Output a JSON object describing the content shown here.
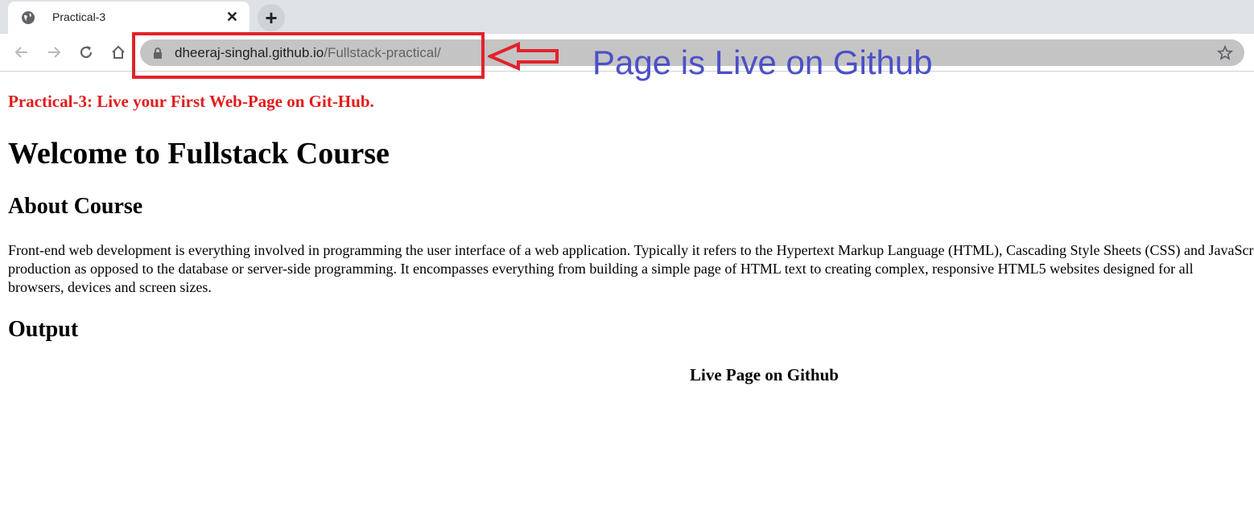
{
  "browser": {
    "tab": {
      "title": "Practical-3",
      "favicon": "globe-icon",
      "close_icon": "close-icon"
    },
    "new_tab_icon": "plus-icon",
    "toolbar": {
      "back_icon": "back-arrow-icon",
      "forward_icon": "forward-arrow-icon",
      "reload_icon": "reload-icon",
      "home_icon": "home-icon",
      "lock_icon": "lock-icon",
      "bookmark_icon": "star-icon",
      "url_host": "dheeraj-singhal.github.io",
      "url_path": "/Fullstack-practical/"
    }
  },
  "annotation": {
    "text": "Page is Live on Github",
    "box_color": "#e2232a",
    "text_color": "#4b50c8"
  },
  "page": {
    "practical_title": "Practical-3: Live your First Web-Page on Git-Hub.",
    "heading": "Welcome to Fullstack Course",
    "about_heading": "About Course",
    "about_lines": [
      "Front-end web development is everything involved in programming the user interface of a web application. Typically it refers to the Hypertext Markup Language (HTML), Cascading Style Sheets (CSS) and JavaScript",
      "production as opposed to the database or server-side programming. It encompasses everything from building a simple page of HTML text to creating complex, responsive HTML5 websites designed for all",
      "browsers, devices and screen sizes."
    ],
    "output_heading": "Output",
    "output_caption": "Live Page on Github",
    "accent_color": "#e31b1b"
  }
}
